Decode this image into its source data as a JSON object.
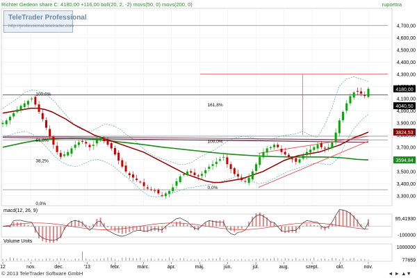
{
  "header": {
    "title": "Richter Gedeon share C: 4180,00 +116,00 boll(20, 2, -2) movs(50, 0) movs(200, 0)",
    "right_label": "ruporttra"
  },
  "logo": {
    "line1": "TeleTrader Professional",
    "line2": "http://professional.teletrader.com"
  },
  "macd_label": "macd(12, 26, 9)",
  "volume_label": "Volume Units",
  "footer": {
    "left": "© 2013 TeleTrader Software GmbH",
    "right": "◄ ► ▲▼"
  },
  "watermark_url": "http://professional.teletrader.com",
  "colors": {
    "price_up": "#00aa00",
    "price_down": "#cc0000",
    "boll": "#55aaaa",
    "ma50": "#8b0000",
    "ma200": "#1a8a1a",
    "trend": "#6a1a3a",
    "channel": "#e06060",
    "macd_hist": "#d46a6a",
    "volume": "#999999"
  },
  "chart_data": [
    {
      "type": "candlestick",
      "x_ticks": [
        "12",
        "nov.",
        "dec.",
        "'13",
        "febr.",
        "márc.",
        "ápr.",
        "máj.",
        "jún.",
        "júl.",
        "aug.",
        "szept.",
        "okt.",
        "nov."
      ],
      "y_ticks": [
        3300,
        3400,
        3500,
        3600,
        3700,
        3800,
        3900,
        4000,
        4100,
        4200,
        4300,
        4400,
        4500,
        4600,
        4700
      ],
      "ylim": [
        3230,
        4830
      ],
      "last_labels": [
        {
          "text": "4180,00",
          "value": 4180,
          "color": "#ffffff",
          "bg": "#000000"
        },
        {
          "text": "4040,50",
          "value": 4040.5,
          "color": "#ffffff",
          "bg": "#000000"
        },
        {
          "text": "3824,53",
          "value": 3824.53,
          "color": "#ffffff",
          "bg": "#8b0000"
        },
        {
          "text": "3594,84",
          "value": 3594.84,
          "color": "#ffffff",
          "bg": "#1a8a1a"
        }
      ],
      "fib_labels": [
        {
          "text": "100,0%",
          "value": 4120,
          "anchor": "left"
        },
        {
          "text": "61,8%",
          "value": 3740,
          "anchor": "left"
        },
        {
          "text": "38,2%",
          "value": 3570,
          "anchor": "left"
        },
        {
          "text": "0,0%",
          "value": 3220,
          "anchor": "left"
        },
        {
          "text": "161,8%",
          "value": 4030,
          "anchor": "right"
        },
        {
          "text": "100,0%",
          "value": 3730,
          "anchor": "right"
        },
        {
          "text": "0,0%",
          "value": 3350,
          "anchor": "right"
        }
      ],
      "horizontal_levels": [
        4700,
        4300,
        4130,
        3790,
        3760,
        3350
      ],
      "close_series": [
        3900,
        3920,
        3950,
        3980,
        4010,
        4040,
        4060,
        4080,
        4100,
        4050,
        3990,
        3930,
        3860,
        3790,
        3720,
        3660,
        3620,
        3640,
        3660,
        3690,
        3720,
        3740,
        3750,
        3730,
        3700,
        3720,
        3760,
        3780,
        3750,
        3720,
        3690,
        3640,
        3590,
        3540,
        3500,
        3470,
        3450,
        3430,
        3410,
        3380,
        3360,
        3350,
        3340,
        3320,
        3300,
        3320,
        3340,
        3370,
        3420,
        3460,
        3480,
        3500,
        3490,
        3470,
        3460,
        3480,
        3510,
        3540,
        3560,
        3580,
        3600,
        3620,
        3560,
        3520,
        3480,
        3460,
        3430,
        3420,
        3450,
        3500,
        3560,
        3620,
        3660,
        3690,
        3700,
        3720,
        3700,
        3660,
        3640,
        3620,
        3600,
        3580,
        3600,
        3630,
        3660,
        3680,
        3700,
        3720,
        3700,
        3690,
        3700,
        3740,
        3820,
        3920,
        3990,
        4060,
        4120,
        4150,
        4160,
        4140,
        4120,
        4180
      ],
      "ma50_series": [
        3980,
        3990,
        4000,
        4010,
        4020,
        4020,
        4010,
        3990,
        3960,
        3930,
        3890,
        3860,
        3830,
        3800,
        3780,
        3760,
        3740,
        3720,
        3700,
        3680,
        3660,
        3630,
        3600,
        3570,
        3540,
        3510,
        3480,
        3460,
        3440,
        3420,
        3410,
        3410,
        3420,
        3430,
        3440,
        3460,
        3480,
        3500,
        3530,
        3560,
        3590,
        3610,
        3630,
        3640,
        3650,
        3660,
        3680,
        3700,
        3720,
        3750,
        3780,
        3800,
        3824
      ],
      "ma200_series": [
        3700,
        3720,
        3740,
        3755,
        3765,
        3770,
        3772,
        3770,
        3765,
        3755,
        3745,
        3735,
        3725,
        3712,
        3700,
        3690,
        3680,
        3670,
        3660,
        3650,
        3642,
        3635,
        3630,
        3625,
        3622,
        3620,
        3620,
        3620,
        3619,
        3617,
        3610,
        3600,
        3595
      ],
      "boll_upper": [
        4020,
        4060,
        4100,
        4150,
        4170,
        4160,
        4130,
        4080,
        4010,
        3940,
        3870,
        3840,
        3830,
        3860,
        3890,
        3880,
        3850,
        3800,
        3760,
        3700,
        3650,
        3620,
        3600,
        3580,
        3560,
        3560,
        3580,
        3620,
        3650,
        3680,
        3720,
        3760,
        3780,
        3790,
        3780,
        3760,
        3750,
        3770,
        3790,
        3800,
        3810,
        3830,
        3800,
        3780,
        3880,
        4020,
        4200,
        4260,
        4280,
        4260,
        4240
      ],
      "boll_lower": [
        3780,
        3800,
        3820,
        3830,
        3810,
        3760,
        3700,
        3630,
        3580,
        3550,
        3540,
        3560,
        3590,
        3600,
        3580,
        3550,
        3500,
        3450,
        3400,
        3340,
        3300,
        3290,
        3300,
        3320,
        3340,
        3360,
        3370,
        3380,
        3390,
        3400,
        3420,
        3440,
        3460,
        3450,
        3420,
        3400,
        3410,
        3440,
        3470,
        3500,
        3520,
        3540,
        3560,
        3570,
        3560,
        3560,
        3620,
        3750,
        3850,
        3920,
        3970
      ],
      "trend_lines": [
        {
          "from": [
            0.0,
            3780
          ],
          "to": [
            1.0,
            3740
          ],
          "color": "#6a1a3a"
        },
        {
          "from": [
            0.0,
            3790
          ],
          "to": [
            1.0,
            3760
          ],
          "color": "#7a4a6a"
        },
        {
          "from": [
            0.7,
            3370
          ],
          "to": [
            1.0,
            3750
          ],
          "color": "#e06060"
        },
        {
          "from": [
            0.7,
            3650
          ],
          "to": [
            1.0,
            3790
          ],
          "color": "#e06060"
        }
      ]
    },
    {
      "type": "macd",
      "label": "macd(12, 26, 9)",
      "y_labels": [
        {
          "text": "95,41930",
          "value": 95419
        },
        {
          "text": "-100000",
          "value": -100000
        }
      ],
      "ylim": [
        -120000,
        130000
      ]
    },
    {
      "type": "volume",
      "label": "Volume Units",
      "y_labels": [
        {
          "text": "1000000",
          "value": 1000000
        },
        {
          "text": "77659",
          "value": 77659
        }
      ],
      "ylim": [
        0,
        1100000
      ]
    }
  ]
}
